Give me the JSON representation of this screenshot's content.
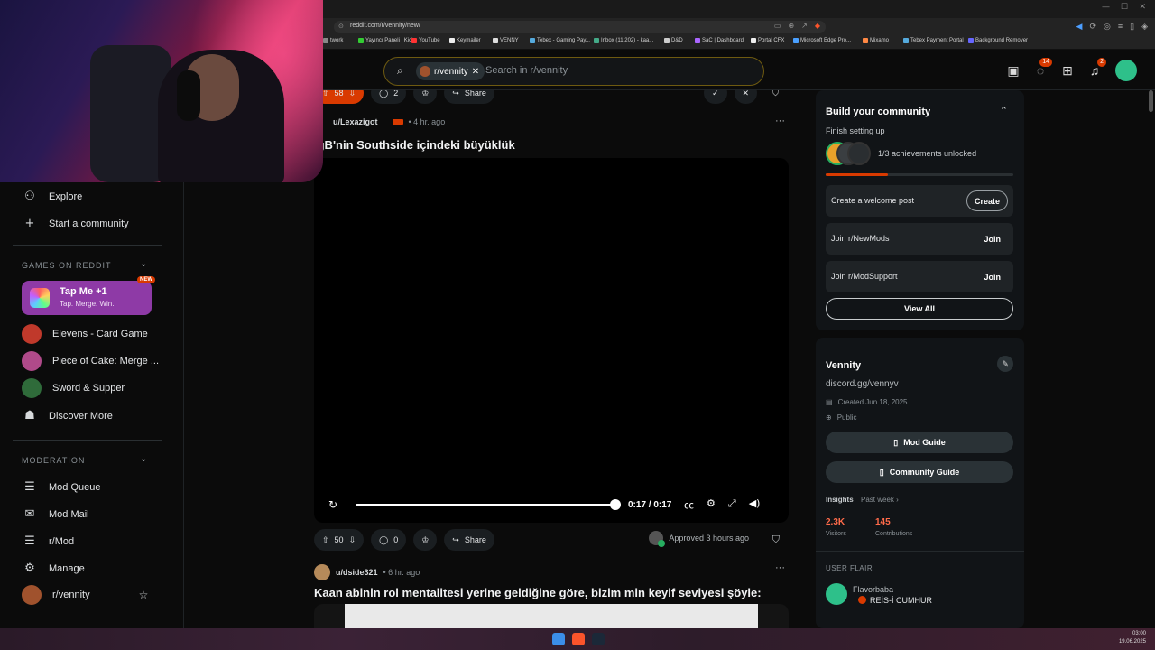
{
  "browser": {
    "url": "reddit.com/r/vennity/new/",
    "bookmarks": [
      "twork",
      "Yayıncı Paneli | Kick",
      "YouTube",
      "Keymailer",
      "VENNY",
      "Tebex - Gaming Pay...",
      "Inbox (11,202) - kaa...",
      "D&D",
      "SaC | Dashboard",
      "Portal CFX",
      "Microsoft Edge Pro...",
      "Mixamo",
      "Tebex Payment Portal",
      "Background Remover"
    ]
  },
  "header": {
    "community_chip": "r/vennity",
    "search_placeholder": "Search in r/vennity",
    "chat_badge": "14",
    "notif_badge": "2"
  },
  "sidebar": {
    "explore": "Explore",
    "start_community": "Start a community",
    "games_heading": "GAMES ON REDDIT",
    "tapme_title": "Tap Me +1",
    "tapme_sub": "Tap. Merge. Win.",
    "new_badge": "NEW",
    "games": [
      "Elevens - Card Game",
      "Piece of Cake: Merge ...",
      "Sword & Supper",
      "Discover More"
    ],
    "moderation_heading": "MODERATION",
    "mod_items": [
      "Mod Queue",
      "Mod Mail",
      "r/Mod",
      "Manage",
      "r/vennity"
    ]
  },
  "feed": {
    "top_actions": {
      "votes": "58",
      "comments": "2",
      "share": "Share"
    },
    "post1": {
      "user": "u/Lexazigot",
      "time": "• 4 hr. ago",
      "title": "igB'nin Southside içindeki büyüklük",
      "video_time": "0:17 / 0:17",
      "video_progress": 1.0,
      "votes": "50",
      "comments": "0",
      "share": "Share",
      "approved": "Approved 3 hours ago"
    },
    "post2": {
      "user": "u/dside321",
      "time": "• 6 hr. ago",
      "title": "Kaan abinin rol mentalitesi yerine geldiğine göre, bizim min keyif seviyesi şöyle:"
    }
  },
  "right": {
    "build_title": "Build your community",
    "finish_setup": "Finish setting up",
    "achievements": "1/3 achievements unlocked",
    "achievement_progress": 0.33,
    "tasks": [
      {
        "label": "Create a welcome post",
        "btn": "Create"
      },
      {
        "label": "Join r/NewMods",
        "btn": "Join"
      },
      {
        "label": "Join r/ModSupport",
        "btn": "Join"
      }
    ],
    "view_all": "View All",
    "community_name": "Vennity",
    "community_desc": "discord.gg/vennyv",
    "created": "Created Jun 18, 2025",
    "visibility": "Public",
    "mod_guide": "Mod Guide",
    "community_guide": "Community Guide",
    "insights": "Insights",
    "past_week": "Past week ›",
    "visitors_value": "2.3K",
    "visitors_label": "Visitors",
    "contrib_value": "145",
    "contrib_label": "Contributions",
    "user_flair_heading": "USER FLAIR",
    "flair_user": "Flavorbaba",
    "flair_text": "REİS-İ CUMHUR"
  },
  "taskbar": {
    "time": "03:00",
    "date": "19.06.2025"
  }
}
